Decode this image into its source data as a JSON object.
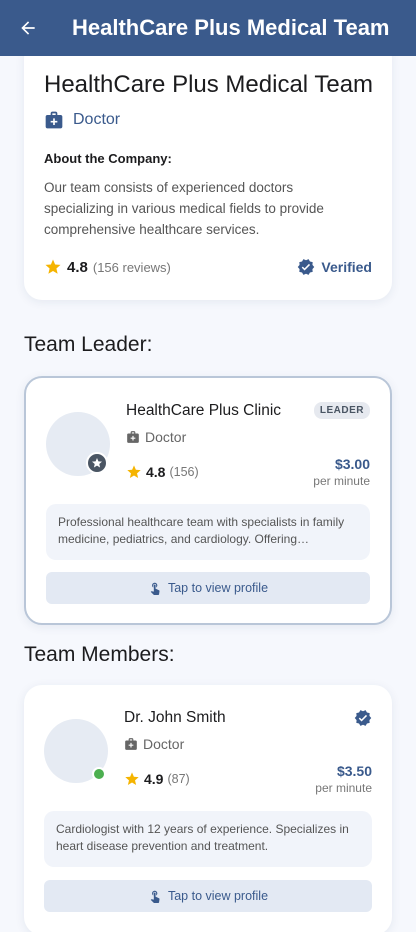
{
  "appbar": {
    "title": "HealthCare Plus Medical Team"
  },
  "company": {
    "name": "HealthCare Plus Medical Team",
    "role": "Doctor",
    "about_heading": "About the Company:",
    "about_text": "Our team consists of experienced doctors specializing in various medical fields to provide comprehensive healthcare services.",
    "rating": "4.8",
    "reviews": "(156 reviews)",
    "verified_label": "Verified"
  },
  "sections": {
    "leader_title": "Team Leader:",
    "members_title": "Team Members:"
  },
  "leader": {
    "name": "HealthCare Plus Clinic",
    "tag": "LEADER",
    "role": "Doctor",
    "rating": "4.8",
    "reviews": "(156)",
    "price": "$3.00",
    "price_unit": "per minute",
    "description": "Professional healthcare team with specialists in family medicine, pediatrics, and cardiology. Offering comprehensive care.",
    "view_label": "Tap to view profile"
  },
  "members": [
    {
      "name": "Dr. John Smith",
      "role": "Doctor",
      "rating": "4.9",
      "reviews": "(87)",
      "price": "$3.50",
      "price_unit": "per minute",
      "description": "Cardiologist with 12 years of experience. Specializes in heart disease prevention and treatment.",
      "view_label": "Tap to view profile"
    }
  ],
  "colors": {
    "primary": "#3a5a8c",
    "star": "#f5b400",
    "online": "#4caf50",
    "background": "#f6f8fd"
  },
  "icons": {
    "back": "arrow-left-icon",
    "role": "medical-bag-icon",
    "star": "star-icon",
    "verified": "verified-check-icon",
    "touch": "touch-hand-icon"
  }
}
